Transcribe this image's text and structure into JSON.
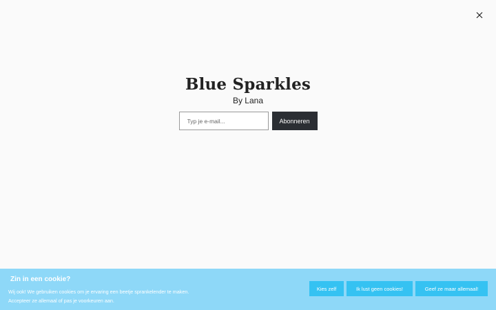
{
  "modal": {
    "close_icon": "close-icon"
  },
  "header": {
    "title": "Blue Sparkles",
    "subtitle": "By Lana"
  },
  "subscribe": {
    "email_placeholder": "Typ je e-mail...",
    "button_label": "Abonneren"
  },
  "cookie_banner": {
    "icon": "cookie-icon",
    "icon_glyph": "",
    "title": "Zin in een cookie?",
    "text_line1": "Wij ook! We gebruiken cookies om je ervaring een beetje sprankelender te maken.",
    "text_line2": "Accepteer ze allemaal of pas je voorkeuren aan.",
    "buttons": {
      "choose": "Kies zelf",
      "decline": "Ik lust geen cookies!",
      "accept": "Geef ze maar allemaal!"
    },
    "colors": {
      "background": "#8ed8f8",
      "button": "#35c2f2"
    }
  }
}
